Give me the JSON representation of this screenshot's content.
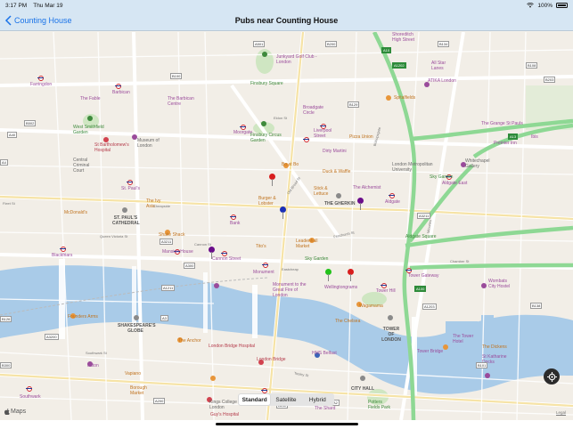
{
  "status_bar": {
    "time": "3:17 PM",
    "date": "Thu Mar 19",
    "battery": "100%"
  },
  "nav": {
    "back_label": "Counting House",
    "title": "Pubs near Counting House"
  },
  "map": {
    "places": [
      {
        "text": "The Fable",
        "cls": "",
        "pos": "place-1"
      },
      {
        "text": "Barbican",
        "cls": "",
        "pos": "place-2"
      },
      {
        "text": "Farringdon",
        "cls": "",
        "pos": "place-3"
      },
      {
        "text": "The Barbican Centre",
        "cls": "",
        "pos": "place-4"
      },
      {
        "text": "Finsbury Square",
        "cls": "green",
        "pos": "place-5"
      },
      {
        "text": "Junkyard Golf Club - London",
        "cls": "",
        "pos": "place-6"
      },
      {
        "text": "Shoreditch High Street",
        "cls": "",
        "pos": "place-7"
      },
      {
        "text": "All Star Lanes",
        "cls": "",
        "pos": "place-8"
      },
      {
        "text": "ATIKA London",
        "cls": "",
        "pos": "place-9"
      },
      {
        "text": "Spitalfields",
        "cls": "orange",
        "pos": "place-10"
      },
      {
        "text": "West Smithfield Garden",
        "cls": "green",
        "pos": "place-11"
      },
      {
        "text": "St Bartholomew's Hospital",
        "cls": "red",
        "pos": "place-12"
      },
      {
        "text": "Museum of London",
        "cls": "grey",
        "pos": "place-13"
      },
      {
        "text": "Moorgate",
        "cls": "",
        "pos": "place-14"
      },
      {
        "text": "Finsbury Circus Garden",
        "cls": "green",
        "pos": "place-15"
      },
      {
        "text": "Broadgate Circle",
        "cls": "",
        "pos": "place-16"
      },
      {
        "text": "Liverpool Street",
        "cls": "",
        "pos": "place-17"
      },
      {
        "text": "Pizza Union",
        "cls": "orange",
        "pos": "place-18"
      },
      {
        "text": "Dirty Martini",
        "cls": "",
        "pos": "place-19"
      },
      {
        "text": "Central Criminal Court",
        "cls": "grey",
        "pos": "place-20"
      },
      {
        "text": "St. Paul's",
        "cls": "",
        "pos": "place-21"
      },
      {
        "text": "London Metropolitan University",
        "cls": "grey",
        "pos": "place-22"
      },
      {
        "text": "Duck & Waffle",
        "cls": "orange",
        "pos": "place-23"
      },
      {
        "text": "Whitechapel Gallery",
        "cls": "grey",
        "pos": "place-24"
      },
      {
        "text": "Aldgate East",
        "cls": "",
        "pos": "place-25"
      },
      {
        "text": "Sky Garden",
        "cls": "green",
        "pos": "place-26"
      },
      {
        "text": "The Alchemist",
        "cls": "",
        "pos": "place-27"
      },
      {
        "text": "Aldgate",
        "cls": "",
        "pos": "place-28"
      },
      {
        "text": "THE GHERKIN",
        "cls": "bold",
        "pos": "place-29"
      },
      {
        "text": "McDonald's",
        "cls": "orange",
        "pos": "place-30"
      },
      {
        "text": "ST. PAUL'S CATHEDRAL",
        "cls": "bold",
        "pos": "place-31"
      },
      {
        "text": "Bank",
        "cls": "",
        "pos": "place-32"
      },
      {
        "text": "Leadenhall Market",
        "cls": "orange",
        "pos": "place-33"
      },
      {
        "text": "Tower Gateway",
        "cls": "",
        "pos": "place-34"
      },
      {
        "text": "Blackfriars",
        "cls": "",
        "pos": "place-35"
      },
      {
        "text": "Mansion House",
        "cls": "",
        "pos": "place-36"
      },
      {
        "text": "Cannon Street",
        "cls": "",
        "pos": "place-37"
      },
      {
        "text": "Monument",
        "cls": "",
        "pos": "place-38"
      },
      {
        "text": "Wellingtongrams",
        "cls": "",
        "pos": "place-39"
      },
      {
        "text": "Tower Hill",
        "cls": "",
        "pos": "place-40"
      },
      {
        "text": "Wombats City Hostel",
        "cls": "",
        "pos": "place-41"
      },
      {
        "text": "Founders Arms",
        "cls": "orange",
        "pos": "place-42"
      },
      {
        "text": "SHAKESPEARE'S GLOBE",
        "cls": "bold",
        "pos": "place-43"
      },
      {
        "text": "TOWER OF LONDON",
        "cls": "bold",
        "pos": "place-44"
      },
      {
        "text": "The Anchor",
        "cls": "orange",
        "pos": "place-45"
      },
      {
        "text": "London Bridge Hospital",
        "cls": "red",
        "pos": "place-46"
      },
      {
        "text": "HMS Belfast",
        "cls": "",
        "pos": "place-47"
      },
      {
        "text": "The Tower Hotel",
        "cls": "",
        "pos": "place-48"
      },
      {
        "text": "Hilton",
        "cls": "",
        "pos": "place-49"
      },
      {
        "text": "Southwark",
        "cls": "",
        "pos": "place-50"
      },
      {
        "text": "London Bridge",
        "cls": "",
        "pos": "place-51"
      },
      {
        "text": "CITY HALL",
        "cls": "bold",
        "pos": "place-52"
      },
      {
        "text": "Guy's Hospital",
        "cls": "red",
        "pos": "place-53"
      },
      {
        "text": "Kings College London",
        "cls": "grey",
        "pos": "place-54"
      },
      {
        "text": "Potters Fields Park",
        "cls": "green",
        "pos": "place-55"
      },
      {
        "text": "Tower Bridge",
        "cls": "",
        "pos": "place-56"
      },
      {
        "text": "The Shard",
        "cls": "",
        "pos": "place-57"
      },
      {
        "text": "Shake Shack",
        "cls": "orange",
        "pos": "place-58"
      },
      {
        "text": "The Ivy Asia",
        "cls": "orange",
        "pos": "place-59"
      },
      {
        "text": "Monument to the Great Fire of London",
        "cls": "",
        "pos": "place-60"
      },
      {
        "text": "The Chelsea",
        "cls": "orange",
        "pos": "place-61"
      },
      {
        "text": "Wagamama",
        "cls": "orange",
        "pos": "place-62"
      },
      {
        "text": "Tito's",
        "cls": "orange",
        "pos": "place-63"
      },
      {
        "text": "Burger & Lobster",
        "cls": "orange",
        "pos": "place-64"
      },
      {
        "text": "Bo at Bo",
        "cls": "orange",
        "pos": "place-65"
      },
      {
        "text": "Stick & Lettuce",
        "cls": "orange",
        "pos": "place-66"
      },
      {
        "text": "Sky Garden",
        "cls": "green",
        "pos": "place-67"
      },
      {
        "text": "The Grange St Pauls",
        "cls": "",
        "pos": "place-68"
      },
      {
        "text": "Premier Inn",
        "cls": "",
        "pos": "place-69"
      },
      {
        "text": "Ibis",
        "cls": "",
        "pos": "place-70"
      },
      {
        "text": "Aldgate Square",
        "cls": "green",
        "pos": "place-71"
      },
      {
        "text": "Vapiano",
        "cls": "orange",
        "pos": "place-72"
      },
      {
        "text": "Borough Market",
        "cls": "orange",
        "pos": "place-73"
      },
      {
        "text": "The Dickens",
        "cls": "orange",
        "pos": "place-74"
      },
      {
        "text": "St Katharine Docks",
        "cls": "",
        "pos": "place-75"
      }
    ],
    "streets": [
      {
        "text": "Eldon St",
        "pos": "street-1"
      },
      {
        "text": "Fenchurch St",
        "pos": "street-2"
      },
      {
        "text": "Eastcheap",
        "pos": "street-3"
      },
      {
        "text": "Old Broad St",
        "pos": "street-4"
      },
      {
        "text": "Queen Victoria St",
        "pos": "street-5"
      },
      {
        "text": "Cannon St",
        "pos": "street-6"
      },
      {
        "text": "Southwark St",
        "pos": "street-7"
      },
      {
        "text": "Tooley St",
        "pos": "street-8"
      },
      {
        "text": "Chamber St",
        "pos": "street-9"
      },
      {
        "text": "Minories",
        "pos": "street-10"
      },
      {
        "text": "Cheapside",
        "pos": "street-11"
      },
      {
        "text": "Fleet St",
        "pos": "street-12"
      },
      {
        "text": "Bishopsgate",
        "pos": "street-13"
      }
    ],
    "road_badges": [
      {
        "text": "B100",
        "pos": "badge-1",
        "green": false
      },
      {
        "text": "A501",
        "pos": "badge-2",
        "green": false
      },
      {
        "text": "B134",
        "pos": "badge-3",
        "green": false
      },
      {
        "text": "A1202",
        "pos": "badge-4",
        "green": true
      },
      {
        "text": "B108",
        "pos": "badge-5",
        "green": false
      },
      {
        "text": "B502",
        "pos": "badge-6",
        "green": false
      },
      {
        "text": "A40",
        "pos": "badge-7",
        "green": false
      },
      {
        "text": "A4",
        "pos": "badge-8",
        "green": false
      },
      {
        "text": "A13",
        "pos": "badge-9",
        "green": true
      },
      {
        "text": "A3211",
        "pos": "badge-10",
        "green": false
      },
      {
        "text": "A3211",
        "pos": "badge-11",
        "green": false
      },
      {
        "text": "A100",
        "pos": "badge-12",
        "green": true
      },
      {
        "text": "A1203",
        "pos": "badge-13",
        "green": false
      },
      {
        "text": "A3200",
        "pos": "badge-14",
        "green": false
      },
      {
        "text": "A300",
        "pos": "badge-15",
        "green": false
      },
      {
        "text": "B300",
        "pos": "badge-16",
        "green": false
      },
      {
        "text": "B126",
        "pos": "badge-17",
        "green": false
      },
      {
        "text": "A10",
        "pos": "badge-18",
        "green": true
      },
      {
        "text": "B138",
        "pos": "badge-19",
        "green": false
      },
      {
        "text": "A1211",
        "pos": "badge-20",
        "green": false
      },
      {
        "text": "B129",
        "pos": "badge-21",
        "green": false
      },
      {
        "text": "A2",
        "pos": "badge-22",
        "green": false
      },
      {
        "text": "A200",
        "pos": "badge-23",
        "green": false
      },
      {
        "text": "B202",
        "pos": "badge-24",
        "green": false
      },
      {
        "text": "A3",
        "pos": "badge-25",
        "green": false
      },
      {
        "text": "B101",
        "pos": "badge-26",
        "green": false
      },
      {
        "text": "B200",
        "pos": "badge-27",
        "green": false
      },
      {
        "text": "B203",
        "pos": "badge-28",
        "green": false
      }
    ]
  },
  "pins": [
    {
      "color": "#d81e1e",
      "pos": "pin-1"
    },
    {
      "color": "#1a2fb8",
      "pos": "pin-2"
    },
    {
      "color": "#6a0d8a",
      "pos": "pin-3"
    },
    {
      "color": "#6a0d8a",
      "pos": "pin-4"
    },
    {
      "color": "#22c21a",
      "pos": "pin-5"
    },
    {
      "color": "#d81e1e",
      "pos": "pin-6"
    }
  ],
  "map_type": {
    "standard": "Standard",
    "satellite": "Satellite",
    "hybrid": "Hybrid",
    "selected": "Standard"
  },
  "attribution": {
    "logo": "Maps",
    "legal": "Legal"
  },
  "colors": {
    "bar": "#d6e6f3",
    "accent": "#1a73e8",
    "water": "#a9cbe8",
    "park": "#cfe6c2",
    "tube": "#d1232a"
  }
}
